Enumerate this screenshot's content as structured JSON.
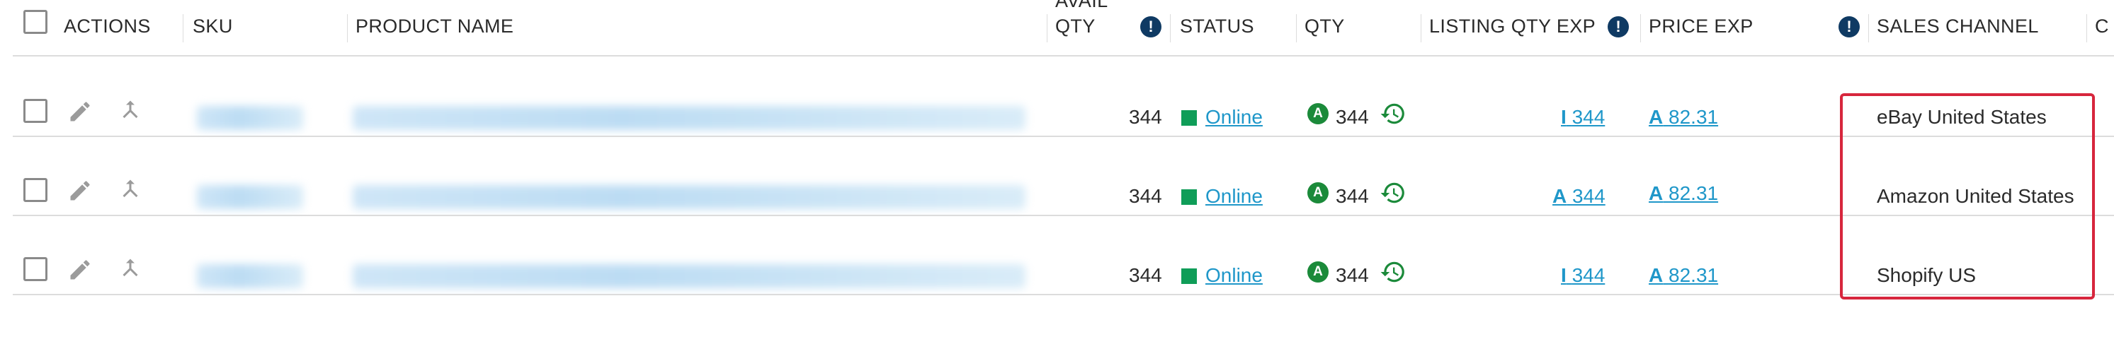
{
  "header": {
    "actions": "ACTIONS",
    "sku": "SKU",
    "product_name": "PRODUCT NAME",
    "avail_qty_line1": "AVAIL",
    "avail_qty_line2": "QTY",
    "status": "STATUS",
    "qty": "QTY",
    "listing_qty_exp": "LISTING QTY EXP",
    "price_exp": "PRICE EXP",
    "sales_channel": "SALES CHANNEL",
    "next_col_partial": "C"
  },
  "rows": [
    {
      "avail_qty": "344",
      "status": "Online",
      "qty_badge": "A",
      "qty": "344",
      "listing_prefix": "I",
      "listing_value": "344",
      "price_prefix": "A",
      "price_value": "82.31",
      "sales_channel": "eBay United States"
    },
    {
      "avail_qty": "344",
      "status": "Online",
      "qty_badge": "A",
      "qty": "344",
      "listing_prefix": "A",
      "listing_value": "344",
      "price_prefix": "A",
      "price_value": "82.31",
      "sales_channel": "Amazon United States"
    },
    {
      "avail_qty": "344",
      "status": "Online",
      "qty_badge": "A",
      "qty": "344",
      "listing_prefix": "I",
      "listing_value": "344",
      "price_prefix": "A",
      "price_value": "82.31",
      "sales_channel": "Shopify US"
    }
  ],
  "icons": {
    "info": "info-icon",
    "edit": "pencil-icon",
    "merge": "merge-icon",
    "history": "history-icon"
  },
  "colors": {
    "status_online": "#0f9d58",
    "link": "#1f97c9",
    "info_icon": "#0f3a63",
    "highlight": "#d7263d"
  }
}
